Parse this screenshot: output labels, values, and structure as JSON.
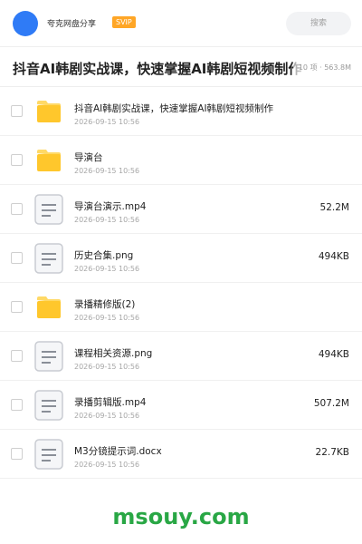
{
  "header": {
    "brand": "夸克网盘分享",
    "badge": "SVIP",
    "search_placeholder": "搜索"
  },
  "folder": {
    "title": "抖音AI韩剧实战课，快速掌握AI韩剧短视频制作",
    "meta": "10 项 · 563.8M"
  },
  "files": [
    {
      "name": "抖音AI韩剧实战课，快速掌握AI韩剧短视频制作",
      "date": "2026-09-15 10:56",
      "size": "",
      "type": "folder"
    },
    {
      "name": "导演台",
      "date": "2026-09-15 10:56",
      "size": "",
      "type": "folder"
    },
    {
      "name": "导演台演示.mp4",
      "date": "2026-09-15 10:56",
      "size": "52.2M",
      "type": "file"
    },
    {
      "name": "历史合集.png",
      "date": "2026-09-15 10:56",
      "size": "494KB",
      "type": "file"
    },
    {
      "name": "录播精修版(2)",
      "date": "2026-09-15 10:56",
      "size": "",
      "type": "folder"
    },
    {
      "name": "课程相关资源.png",
      "date": "2026-09-15 10:56",
      "size": "494KB",
      "type": "file"
    },
    {
      "name": "录播剪辑版.mp4",
      "date": "2026-09-15 10:56",
      "size": "507.2M",
      "type": "file"
    },
    {
      "name": "M3分镜提示词.docx",
      "date": "2026-09-15 10:56",
      "size": "22.7KB",
      "type": "file"
    }
  ],
  "footer": {
    "watermark": "msouy.com"
  },
  "colors": {
    "accent": "#2f7bf6",
    "badge": "#ffa626",
    "folder": "#ffc72c",
    "watermark": "#29a745"
  }
}
